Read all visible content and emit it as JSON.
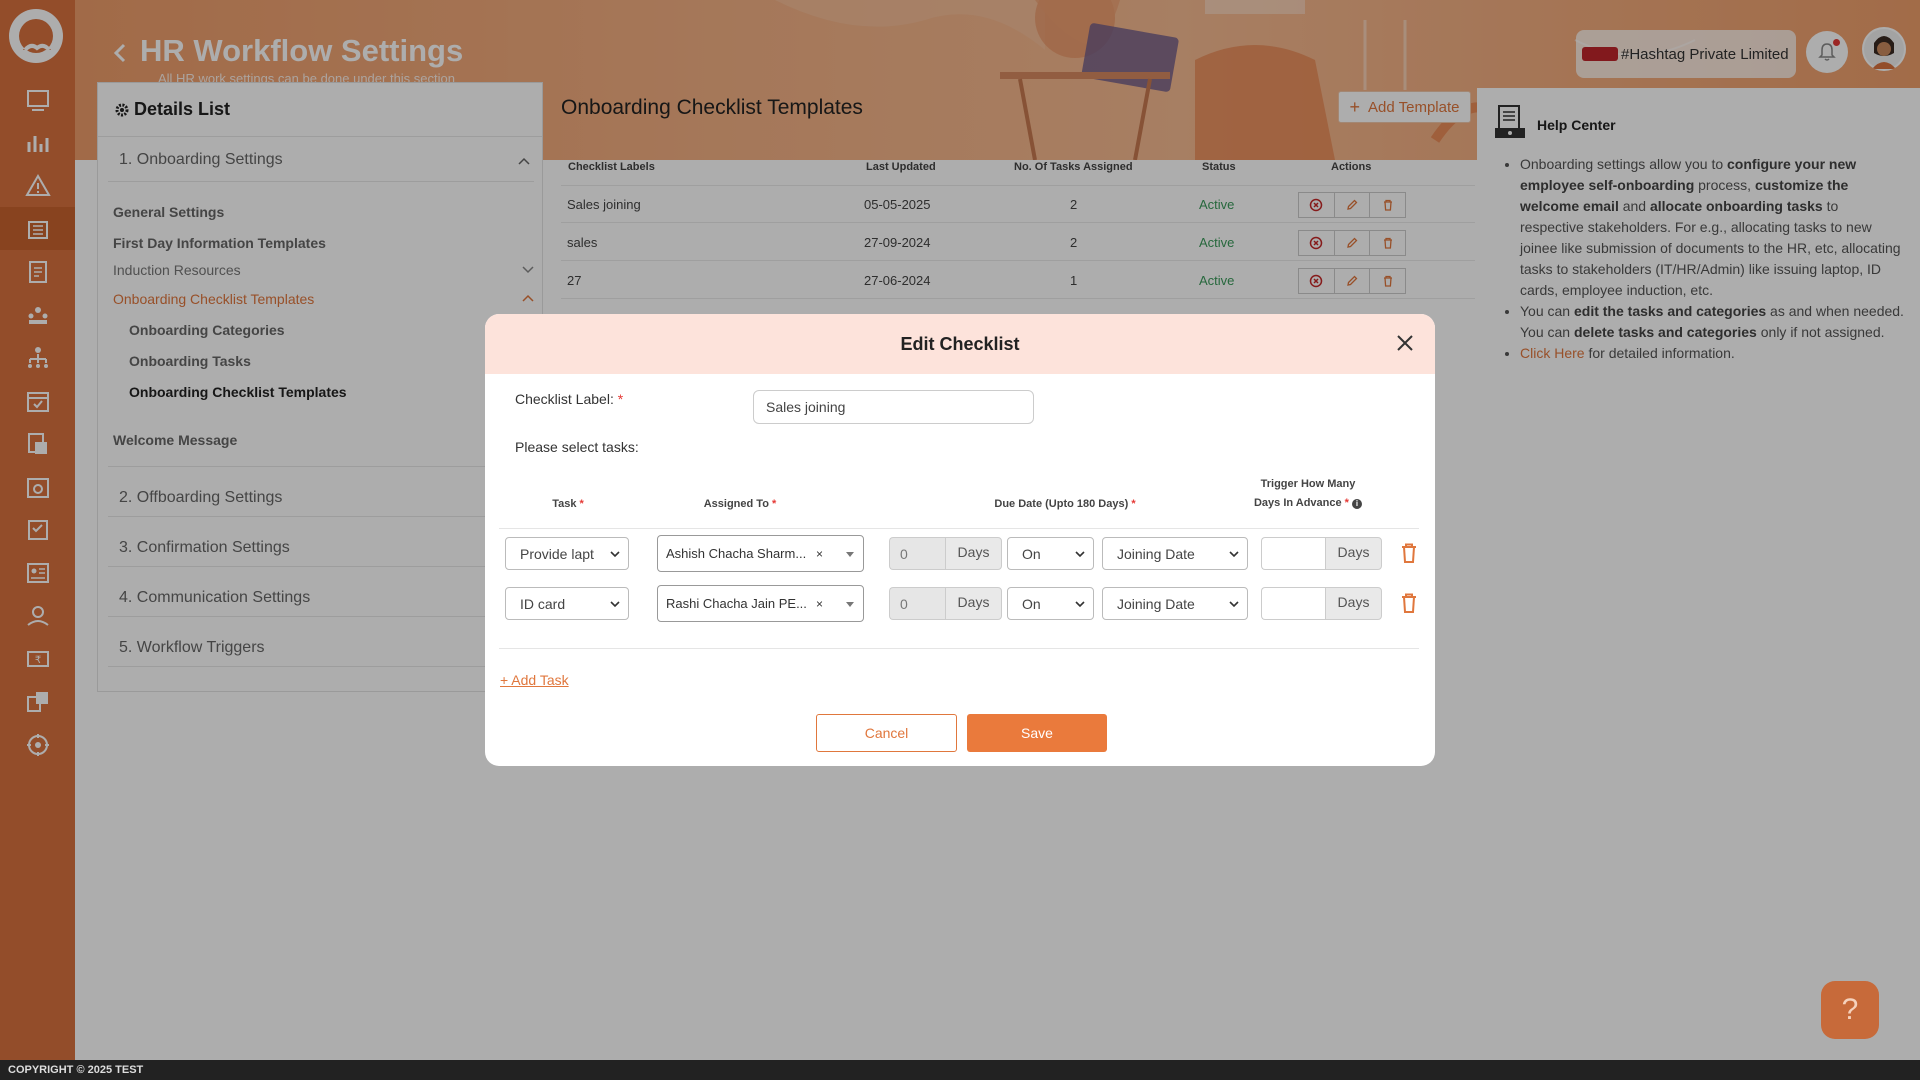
{
  "header": {
    "title": "HR Workflow Settings",
    "subtitle": "All HR work settings can be done under this section",
    "company": "#Hashtag Private Limited"
  },
  "sidebar": {
    "icons": [
      "dashboard-icon",
      "analytics-icon",
      "alert-icon",
      "organization-icon",
      "reports-icon",
      "team-icon",
      "hierarchy-icon",
      "calendar-check-icon",
      "documents-icon",
      "leave-calendar-icon",
      "tasks-icon",
      "employee-list-icon",
      "care-icon",
      "payroll-icon",
      "assets-icon",
      "settings-icon"
    ],
    "active_index": 3
  },
  "details": {
    "title": "Details List",
    "sections": [
      {
        "label": "1. Onboarding Settings"
      },
      {
        "label": "2. Offboarding Settings"
      },
      {
        "label": "3. Confirmation Settings"
      },
      {
        "label": "4. Communication Settings"
      },
      {
        "label": "5. Workflow Triggers"
      }
    ],
    "onboarding_items": {
      "general": "General Settings",
      "first_day": "First Day Information Templates",
      "induction": "Induction Resources",
      "checklist": "Onboarding Checklist Templates",
      "categories": "Onboarding Categories",
      "tasks": "Onboarding Tasks",
      "checklist_templates": "Onboarding Checklist Templates",
      "welcome": "Welcome Message"
    }
  },
  "list": {
    "title": "Onboarding Checklist Templates",
    "add_button": "Add Template",
    "columns": [
      "Checklist Labels",
      "Last Updated",
      "No. Of Tasks Assigned",
      "Status",
      "Actions"
    ],
    "rows": [
      {
        "label": "Sales joining",
        "updated": "05-05-2025",
        "tasks": "2",
        "status": "Active"
      },
      {
        "label": "sales",
        "updated": "27-09-2024",
        "tasks": "2",
        "status": "Active"
      },
      {
        "label": "27",
        "updated": "27-06-2024",
        "tasks": "1",
        "status": "Active"
      }
    ]
  },
  "help": {
    "title": "Help Center",
    "b1_1": "Onboarding settings allow you to ",
    "b1_2": "configure your new employee self-onboarding",
    "b1_3": " process, ",
    "b1_4": "customize the welcome email",
    "b1_5": " and ",
    "b1_6": "allocate onboarding tasks",
    "b1_7": " to respective stakeholders. For e.g., allocating tasks to new joinee like submission of documents to the HR, etc, allocating tasks to stakeholders (IT/HR/Admin) like issuing laptop, ID cards, employee induction, etc.",
    "b2_1": "You can ",
    "b2_2": "edit the tasks and categories",
    "b2_3": " as and when needed. You can ",
    "b2_4": "delete tasks and categories",
    "b2_5": " only if not assigned.",
    "b3_link": "Click Here",
    "b3_rest": " for detailed information."
  },
  "modal": {
    "title": "Edit Checklist",
    "label_caption": "Checklist Label:",
    "label_value": "Sales joining",
    "select_tasks": "Please select tasks:",
    "col_task": "Task",
    "col_assigned": "Assigned To",
    "col_due": "Due Date (Upto 180 Days)",
    "col_trigger_1": "Trigger How Many",
    "col_trigger_2": "Days In Advance",
    "rows": [
      {
        "task": "Provide lapt",
        "assigned": "Ashish Chacha Sharm...",
        "days": "0",
        "unit": "Days",
        "when": "On",
        "ref": "Joining Date",
        "adv": "",
        "adv_unit": "Days"
      },
      {
        "task": "ID card",
        "assigned": "Rashi Chacha Jain PE...",
        "days": "0",
        "unit": "Days",
        "when": "On",
        "ref": "Joining Date",
        "adv": "",
        "adv_unit": "Days"
      }
    ],
    "add_task": "+ Add Task",
    "cancel": "Cancel",
    "save": "Save"
  },
  "footer": {
    "text": "COPYRIGHT © 2025 TEST"
  },
  "fab": {
    "label": "?"
  },
  "colors": {
    "accent": "#e0773d",
    "sidebar": "#d9723f",
    "active": "#3a9a5a",
    "modal_header": "#fde3db"
  }
}
